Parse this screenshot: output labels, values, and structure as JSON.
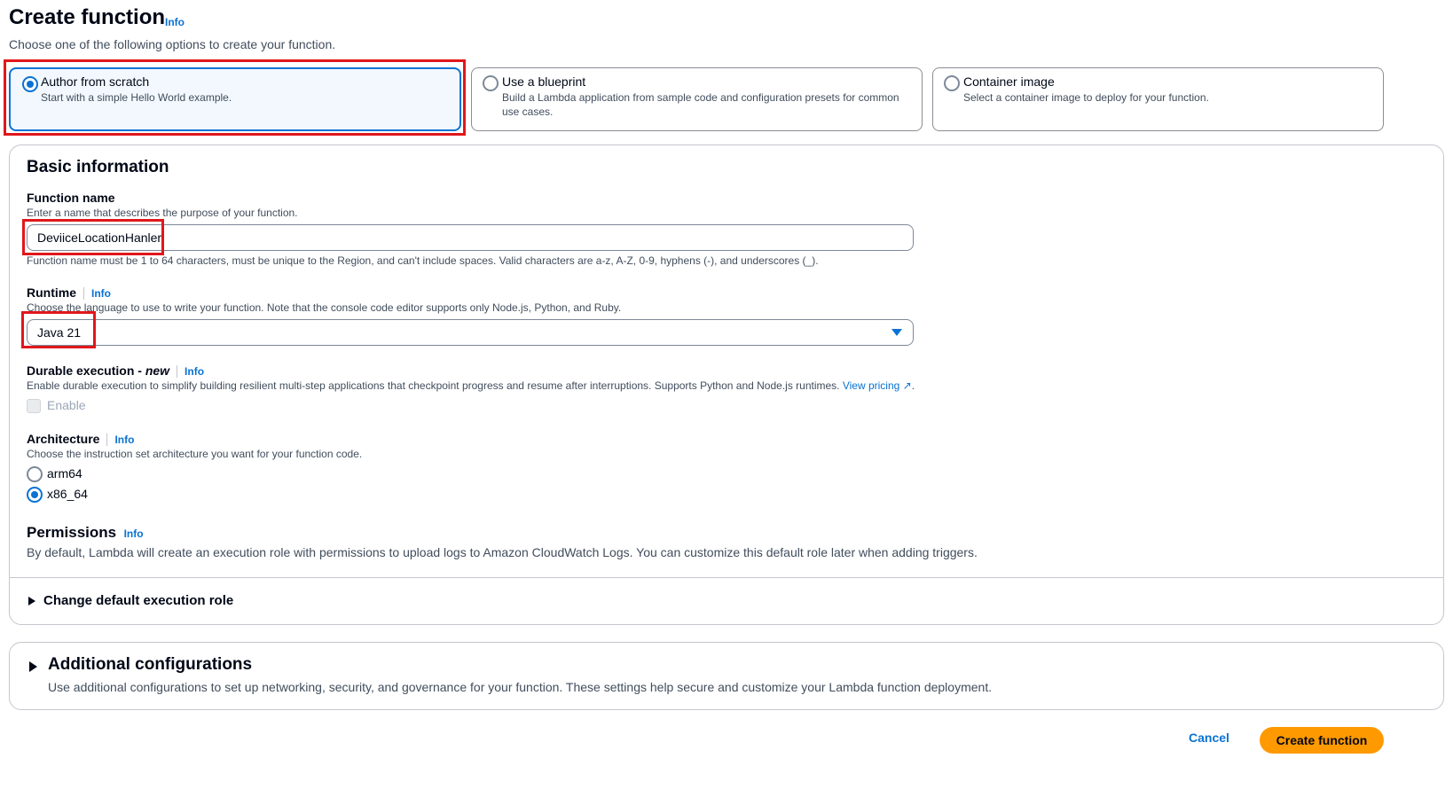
{
  "header": {
    "title": "Create function",
    "info": "Info",
    "subtitle": "Choose one of the following options to create your function."
  },
  "options": [
    {
      "title": "Author from scratch",
      "desc": "Start with a simple Hello World example.",
      "selected": true
    },
    {
      "title": "Use a blueprint",
      "desc": "Build a Lambda application from sample code and configuration presets for common use cases.",
      "selected": false
    },
    {
      "title": "Container image",
      "desc": "Select a container image to deploy for your function.",
      "selected": false
    }
  ],
  "basic": {
    "heading": "Basic information",
    "function_name": {
      "label": "Function name",
      "desc": "Enter a name that describes the purpose of your function.",
      "value": "DeviiceLocationHanler",
      "constraint": "Function name must be 1 to 64 characters, must be unique to the Region, and can't include spaces. Valid characters are a-z, A-Z, 0-9, hyphens (-), and underscores (_)."
    },
    "runtime": {
      "label": "Runtime",
      "info": "Info",
      "desc": "Choose the language to use to write your function. Note that the console code editor supports only Node.js, Python, and Ruby.",
      "value": "Java 21"
    },
    "durable": {
      "label": "Durable execution -",
      "label_new": "new",
      "info": "Info",
      "desc": "Enable durable execution to simplify building resilient multi-step applications that checkpoint progress and resume after interruptions. Supports Python and Node.js runtimes.",
      "pricing_link": "View pricing",
      "checkbox_label": "Enable"
    },
    "architecture": {
      "label": "Architecture",
      "info": "Info",
      "desc": "Choose the instruction set architecture you want for your function code.",
      "options": [
        "arm64",
        "x86_64"
      ],
      "selected": "x86_64"
    },
    "permissions": {
      "heading": "Permissions",
      "info": "Info",
      "desc": "By default, Lambda will create an execution role with permissions to upload logs to Amazon CloudWatch Logs. You can customize this default role later when adding triggers."
    },
    "change_role": "Change default execution role"
  },
  "additional": {
    "heading": "Additional configurations",
    "desc": "Use additional configurations to set up networking, security, and governance for your function. These settings help secure and customize your Lambda function deployment."
  },
  "footer": {
    "cancel": "Cancel",
    "create": "Create function"
  },
  "colors": {
    "accent": "#0972d3",
    "primary_button": "#ff9900",
    "highlight": "#e0171c"
  }
}
